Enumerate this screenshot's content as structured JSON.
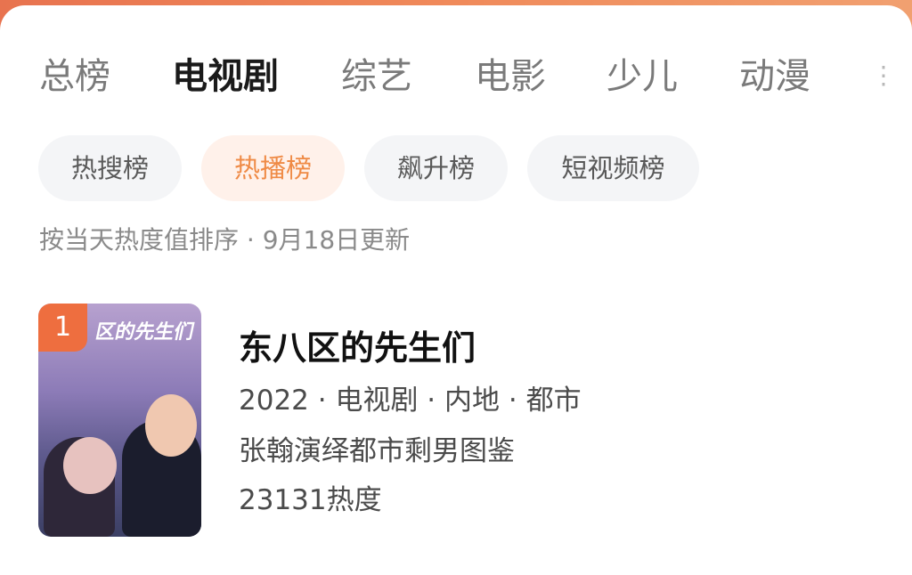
{
  "tabs": [
    "总榜",
    "电视剧",
    "综艺",
    "电影",
    "少儿",
    "动漫"
  ],
  "active_tab_index": 1,
  "filters": [
    "热搜榜",
    "热播榜",
    "飙升榜",
    "短视频榜"
  ],
  "active_filter_index": 1,
  "note": "按当天热度值排序 · 9月18日更新",
  "list": [
    {
      "rank": "1",
      "title": "东八区的先生们",
      "meta": "2022 · 电视剧 · 内地 · 都市",
      "desc": "张翰演绎都市剩男图鉴",
      "heat": "23131热度",
      "poster_title": "区的先生们"
    }
  ],
  "colors": {
    "accent": "#ee6e3f",
    "active_filter_bg": "#fff1ea",
    "active_filter_text": "#ef8a45"
  }
}
